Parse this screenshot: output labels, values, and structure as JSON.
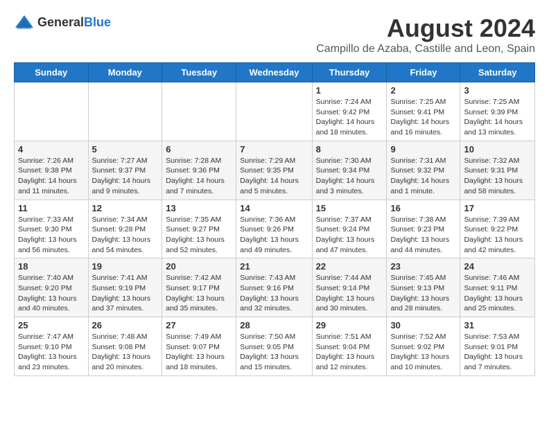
{
  "header": {
    "logo_general": "General",
    "logo_blue": "Blue",
    "main_title": "August 2024",
    "subtitle": "Campillo de Azaba, Castille and Leon, Spain"
  },
  "days_of_week": [
    "Sunday",
    "Monday",
    "Tuesday",
    "Wednesday",
    "Thursday",
    "Friday",
    "Saturday"
  ],
  "weeks": [
    {
      "id": "week1",
      "days": [
        {
          "num": "",
          "info": ""
        },
        {
          "num": "",
          "info": ""
        },
        {
          "num": "",
          "info": ""
        },
        {
          "num": "",
          "info": ""
        },
        {
          "num": "1",
          "info": "Sunrise: 7:24 AM\nSunset: 9:42 PM\nDaylight: 14 hours\nand 18 minutes."
        },
        {
          "num": "2",
          "info": "Sunrise: 7:25 AM\nSunset: 9:41 PM\nDaylight: 14 hours\nand 16 minutes."
        },
        {
          "num": "3",
          "info": "Sunrise: 7:25 AM\nSunset: 9:39 PM\nDaylight: 14 hours\nand 13 minutes."
        }
      ]
    },
    {
      "id": "week2",
      "days": [
        {
          "num": "4",
          "info": "Sunrise: 7:26 AM\nSunset: 9:38 PM\nDaylight: 14 hours\nand 11 minutes."
        },
        {
          "num": "5",
          "info": "Sunrise: 7:27 AM\nSunset: 9:37 PM\nDaylight: 14 hours\nand 9 minutes."
        },
        {
          "num": "6",
          "info": "Sunrise: 7:28 AM\nSunset: 9:36 PM\nDaylight: 14 hours\nand 7 minutes."
        },
        {
          "num": "7",
          "info": "Sunrise: 7:29 AM\nSunset: 9:35 PM\nDaylight: 14 hours\nand 5 minutes."
        },
        {
          "num": "8",
          "info": "Sunrise: 7:30 AM\nSunset: 9:34 PM\nDaylight: 14 hours\nand 3 minutes."
        },
        {
          "num": "9",
          "info": "Sunrise: 7:31 AM\nSunset: 9:32 PM\nDaylight: 14 hours\nand 1 minute."
        },
        {
          "num": "10",
          "info": "Sunrise: 7:32 AM\nSunset: 9:31 PM\nDaylight: 13 hours\nand 58 minutes."
        }
      ]
    },
    {
      "id": "week3",
      "days": [
        {
          "num": "11",
          "info": "Sunrise: 7:33 AM\nSunset: 9:30 PM\nDaylight: 13 hours\nand 56 minutes."
        },
        {
          "num": "12",
          "info": "Sunrise: 7:34 AM\nSunset: 9:28 PM\nDaylight: 13 hours\nand 54 minutes."
        },
        {
          "num": "13",
          "info": "Sunrise: 7:35 AM\nSunset: 9:27 PM\nDaylight: 13 hours\nand 52 minutes."
        },
        {
          "num": "14",
          "info": "Sunrise: 7:36 AM\nSunset: 9:26 PM\nDaylight: 13 hours\nand 49 minutes."
        },
        {
          "num": "15",
          "info": "Sunrise: 7:37 AM\nSunset: 9:24 PM\nDaylight: 13 hours\nand 47 minutes."
        },
        {
          "num": "16",
          "info": "Sunrise: 7:38 AM\nSunset: 9:23 PM\nDaylight: 13 hours\nand 44 minutes."
        },
        {
          "num": "17",
          "info": "Sunrise: 7:39 AM\nSunset: 9:22 PM\nDaylight: 13 hours\nand 42 minutes."
        }
      ]
    },
    {
      "id": "week4",
      "days": [
        {
          "num": "18",
          "info": "Sunrise: 7:40 AM\nSunset: 9:20 PM\nDaylight: 13 hours\nand 40 minutes."
        },
        {
          "num": "19",
          "info": "Sunrise: 7:41 AM\nSunset: 9:19 PM\nDaylight: 13 hours\nand 37 minutes."
        },
        {
          "num": "20",
          "info": "Sunrise: 7:42 AM\nSunset: 9:17 PM\nDaylight: 13 hours\nand 35 minutes."
        },
        {
          "num": "21",
          "info": "Sunrise: 7:43 AM\nSunset: 9:16 PM\nDaylight: 13 hours\nand 32 minutes."
        },
        {
          "num": "22",
          "info": "Sunrise: 7:44 AM\nSunset: 9:14 PM\nDaylight: 13 hours\nand 30 minutes."
        },
        {
          "num": "23",
          "info": "Sunrise: 7:45 AM\nSunset: 9:13 PM\nDaylight: 13 hours\nand 28 minutes."
        },
        {
          "num": "24",
          "info": "Sunrise: 7:46 AM\nSunset: 9:11 PM\nDaylight: 13 hours\nand 25 minutes."
        }
      ]
    },
    {
      "id": "week5",
      "days": [
        {
          "num": "25",
          "info": "Sunrise: 7:47 AM\nSunset: 9:10 PM\nDaylight: 13 hours\nand 23 minutes."
        },
        {
          "num": "26",
          "info": "Sunrise: 7:48 AM\nSunset: 9:08 PM\nDaylight: 13 hours\nand 20 minutes."
        },
        {
          "num": "27",
          "info": "Sunrise: 7:49 AM\nSunset: 9:07 PM\nDaylight: 13 hours\nand 18 minutes."
        },
        {
          "num": "28",
          "info": "Sunrise: 7:50 AM\nSunset: 9:05 PM\nDaylight: 13 hours\nand 15 minutes."
        },
        {
          "num": "29",
          "info": "Sunrise: 7:51 AM\nSunset: 9:04 PM\nDaylight: 13 hours\nand 12 minutes."
        },
        {
          "num": "30",
          "info": "Sunrise: 7:52 AM\nSunset: 9:02 PM\nDaylight: 13 hours\nand 10 minutes."
        },
        {
          "num": "31",
          "info": "Sunrise: 7:53 AM\nSunset: 9:01 PM\nDaylight: 13 hours\nand 7 minutes."
        }
      ]
    }
  ]
}
